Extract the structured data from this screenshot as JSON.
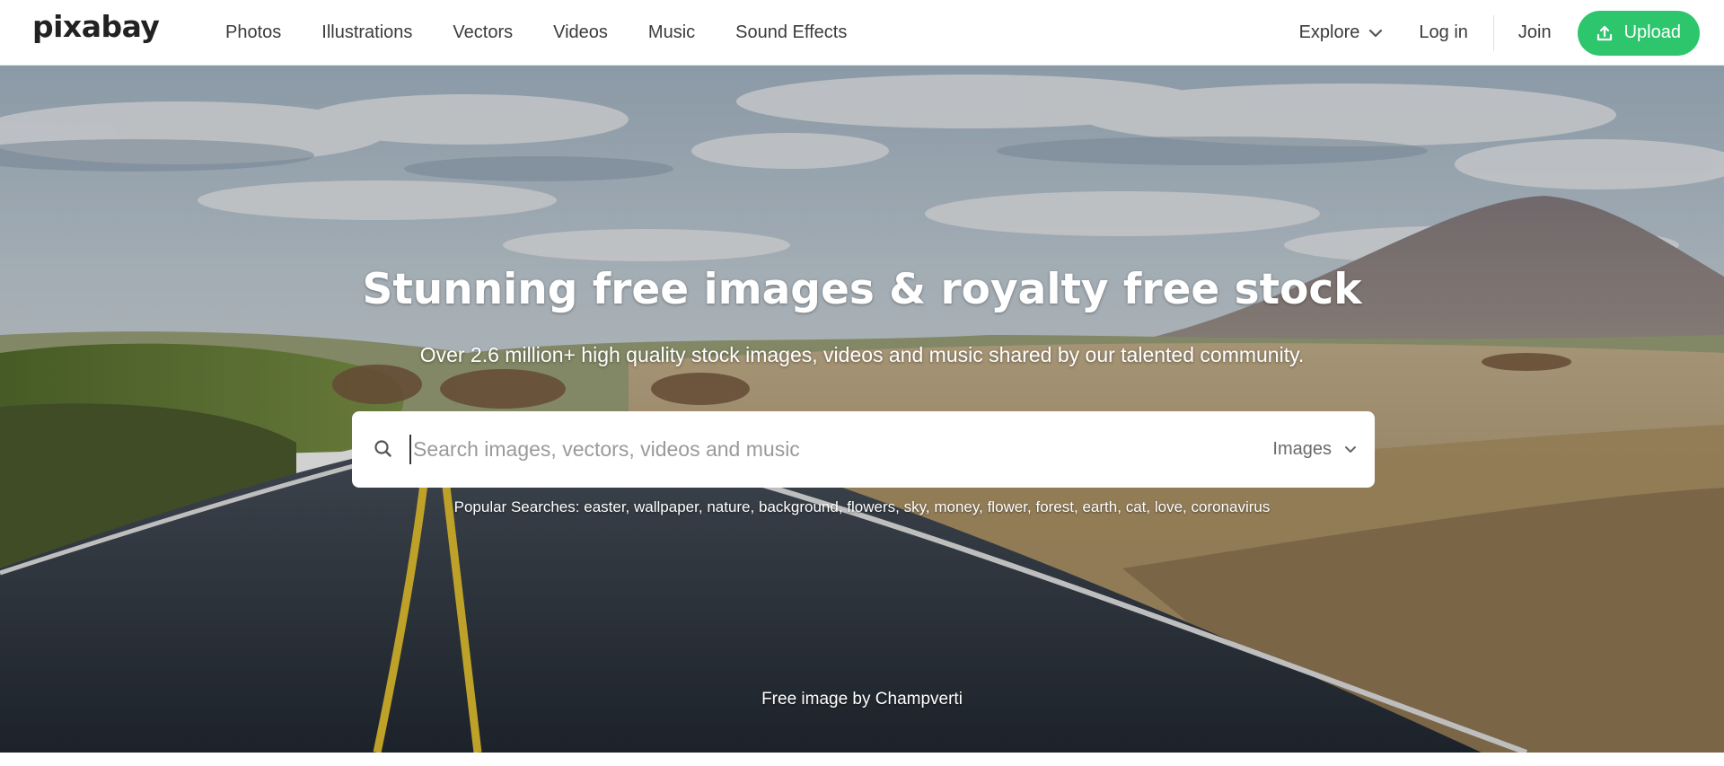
{
  "header": {
    "logo_text": "pixabay",
    "nav": [
      "Photos",
      "Illustrations",
      "Vectors",
      "Videos",
      "Music",
      "Sound Effects"
    ],
    "explore_label": "Explore",
    "login_label": "Log in",
    "join_label": "Join",
    "upload_label": "Upload",
    "upload_color": "#2ec66d"
  },
  "hero": {
    "headline": "Stunning free images & royalty free stock",
    "subline": "Over 2.6 million+ high quality stock images, videos and music shared by our talented community.",
    "search": {
      "placeholder": "Search images, vectors, videos and music",
      "value": "",
      "type_selected": "Images"
    },
    "popular_label": "Popular Searches:",
    "popular_terms": [
      "easter",
      "wallpaper",
      "nature",
      "background",
      "flowers",
      "sky",
      "money",
      "flower",
      "forest",
      "earth",
      "cat",
      "love",
      "coronavirus"
    ],
    "credit": "Free image by Champverti"
  },
  "icons": {
    "explore": "chevron-down-icon",
    "upload": "upload-icon",
    "search": "search-icon",
    "type_select": "chevron-down-icon"
  }
}
